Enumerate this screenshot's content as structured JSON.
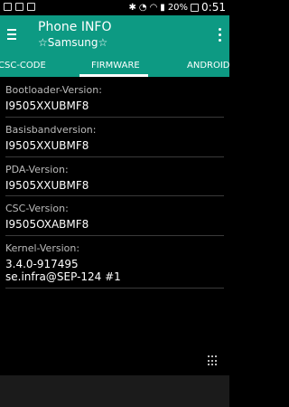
{
  "statusbar": {
    "battery": "20%",
    "time": "0:51",
    "icons": [
      "mail-icon",
      "image-icon",
      "shopping-bag-icon",
      "bluetooth-icon",
      "alarm-icon",
      "wifi-icon",
      "signal-icon",
      "battery-icon"
    ]
  },
  "appbar": {
    "title": "Phone INFO",
    "subtitle": "☆Samsung☆"
  },
  "tabs": [
    {
      "label": "CSC-CODE"
    },
    {
      "label": "FIRMWARE"
    },
    {
      "label": "ANDROID"
    }
  ],
  "items": [
    {
      "label": "Bootloader-Version:",
      "value": "I9505XXUBMF8"
    },
    {
      "label": "Basisbandversion:",
      "value": "I9505XXUBMF8"
    },
    {
      "label": "PDA-Version:",
      "value": "I9505XXUBMF8"
    },
    {
      "label": "CSC-Version:",
      "value": "I9505OXABMF8"
    },
    {
      "label": "Kernel-Version:",
      "value": "3.4.0-917495",
      "value2": "se.infra@SEP-124 #1"
    }
  ]
}
